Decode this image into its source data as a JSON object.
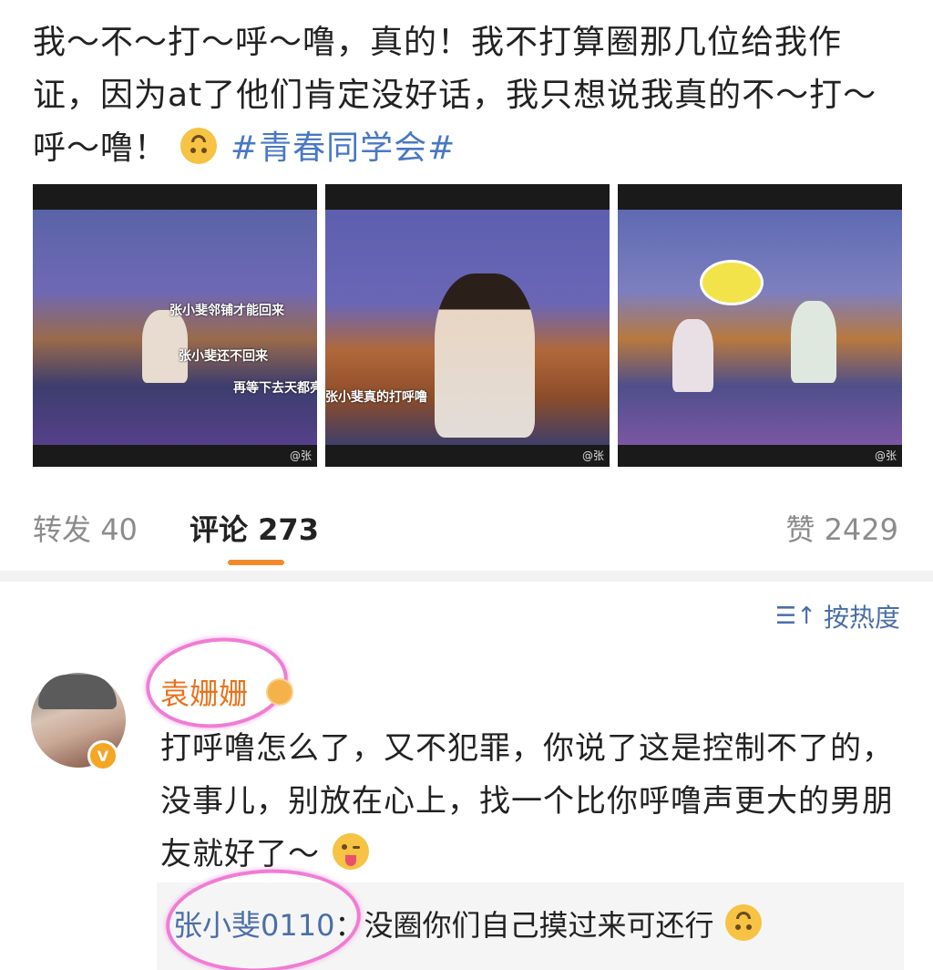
{
  "post": {
    "text": "我～不～打～呼～噜，真的！我不打算圈那几位给我作证，因为at了他们肯定没好话，我只想说我真的不～打～呼～噜！",
    "hashtag": "#青春同学会#",
    "emoji": "upside-down-face"
  },
  "photos": [
    {
      "subtitles": [
        "张小斐邻铺才能回来",
        "张小斐还不回来",
        "再等下去天都亮"
      ],
      "watermark": "@张"
    },
    {
      "subtitles": [
        "张小斐真的打呼噜"
      ],
      "watermark": "@张"
    },
    {
      "subtitles": [],
      "watermark": "@张"
    }
  ],
  "actions": {
    "share_label": "转发",
    "share_count": "40",
    "comment_label": "评论",
    "comment_count": "273",
    "like_label": "赞",
    "like_count": "2429"
  },
  "sort": {
    "label": "按热度",
    "icon": "sort-icon"
  },
  "comment": {
    "username": "袁姗姗",
    "verified_badge": "V",
    "text": "打呼噜怎么了，又不犯罪，你说了这是控制不了的，没事儿，别放在心上，找一个比你呼噜声更大的男朋友就好了～",
    "emoji": "tongue-out-face",
    "reply": {
      "username": "张小斐0110",
      "text": "：没圈你们自己摸过来可还行"
    }
  },
  "colors": {
    "link": "#4a6ea8",
    "username_highlight": "#e8721c",
    "tab_underline": "#f28a2a",
    "annotation_circle": "#f07cd4"
  }
}
